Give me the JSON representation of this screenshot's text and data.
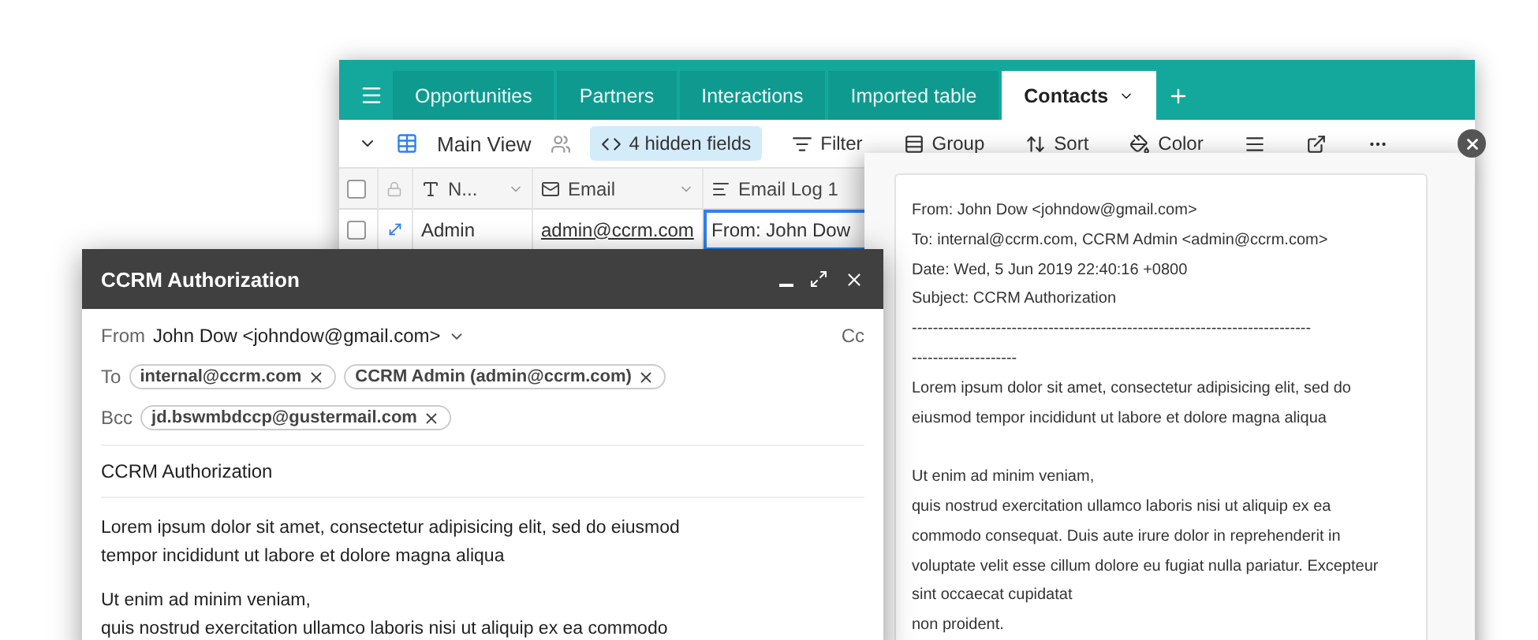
{
  "app": {
    "tabs": [
      {
        "label": "Opportunities",
        "selected": false
      },
      {
        "label": "Partners",
        "selected": false
      },
      {
        "label": "Interactions",
        "selected": false
      },
      {
        "label": "Imported table",
        "selected": false
      },
      {
        "label": "Contacts",
        "selected": true
      }
    ],
    "view": {
      "name": "Main View"
    },
    "toolbar": [
      {
        "kind": "hidden",
        "label": "4 hidden fields",
        "selected": true
      },
      {
        "kind": "filter",
        "label": "Filter",
        "selected": false
      },
      {
        "kind": "group",
        "label": "Group",
        "selected": false
      },
      {
        "kind": "sort",
        "label": "Sort",
        "selected": false
      },
      {
        "kind": "color",
        "label": "Color",
        "selected": false
      },
      {
        "kind": "rowheight",
        "selected": false
      },
      {
        "kind": "share",
        "selected": false
      },
      {
        "kind": "more",
        "selected": false
      }
    ],
    "all_checked": false,
    "columns": [
      {
        "kind": "name",
        "label": "N..."
      },
      {
        "kind": "email",
        "label": "Email"
      },
      {
        "kind": "longtext",
        "label": "Email Log 1"
      }
    ],
    "rows": [
      {
        "checked": false,
        "cells": [
          {
            "text": "Admin",
            "selected": false
          },
          {
            "text": "admin@ccrm.com",
            "selected": false
          },
          {
            "text": "From: John Dow",
            "selected": true
          }
        ]
      }
    ]
  },
  "compose": {
    "title": "CCRM Authorization",
    "from_label": "From",
    "from": "John Dow <johndow@gmail.com>",
    "cc": "Cc",
    "to_label": "To",
    "to": [
      "internal@ccrm.com",
      "CCRM Admin (admin@ccrm.com)"
    ],
    "bcc_label": "Bcc",
    "bcc": [
      "jd.bswmbdccp@gustermail.com"
    ],
    "subject": "CCRM Authorization",
    "body": [
      [
        "Lorem ipsum dolor sit amet, consectetur adipisicing elit, sed do eiusmod",
        "tempor incididunt ut labore et dolore magna aliqua"
      ],
      [
        "Ut enim ad minim veniam,",
        "quis nostrud exercitation ullamco laboris nisi ut aliquip ex ea commodo"
      ]
    ]
  },
  "log": {
    "header": [
      "From: John Dow <johndow@gmail.com>",
      "To: internal@ccrm.com, CCRM Admin <admin@ccrm.com>",
      "Date: Wed, 5 Jun 2019 22:40:16 +0800",
      "Subject: CCRM Authorization"
    ],
    "separator": [
      "----------------------------------------------------------------------------",
      "--------------------"
    ],
    "body": [
      [
        "Lorem ipsum dolor sit amet, consectetur adipisicing elit, sed do",
        "eiusmod tempor incididunt ut labore et dolore magna aliqua"
      ],
      [
        "Ut enim ad minim veniam,",
        "quis nostrud exercitation ullamco laboris nisi ut aliquip ex ea",
        "commodo consequat. Duis aute irure dolor in reprehenderit in",
        "voluptate velit esse cillum dolore eu fugiat nulla pariatur. Excepteur",
        "sint occaecat cupidatat",
        "non proident."
      ]
    ]
  }
}
